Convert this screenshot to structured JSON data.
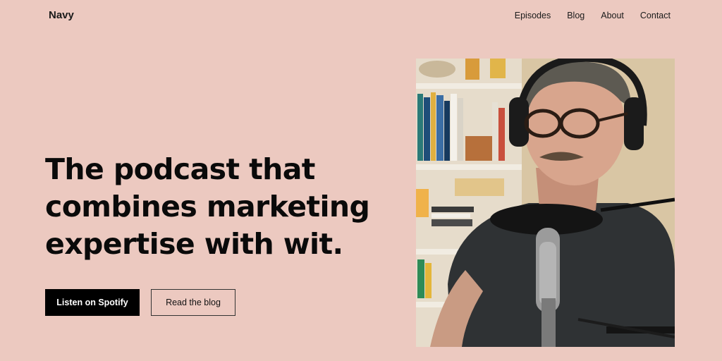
{
  "site": {
    "title": "Navy"
  },
  "nav": {
    "items": [
      "Episodes",
      "Blog",
      "About",
      "Contact"
    ]
  },
  "hero": {
    "headline": "The podcast that combines marketing expertise with wit.",
    "primary_button": "Listen on Spotify",
    "secondary_button": "Read the blog"
  },
  "colors": {
    "background": "#ecc9c0",
    "primary_button": "#000000",
    "text": "#111111"
  }
}
